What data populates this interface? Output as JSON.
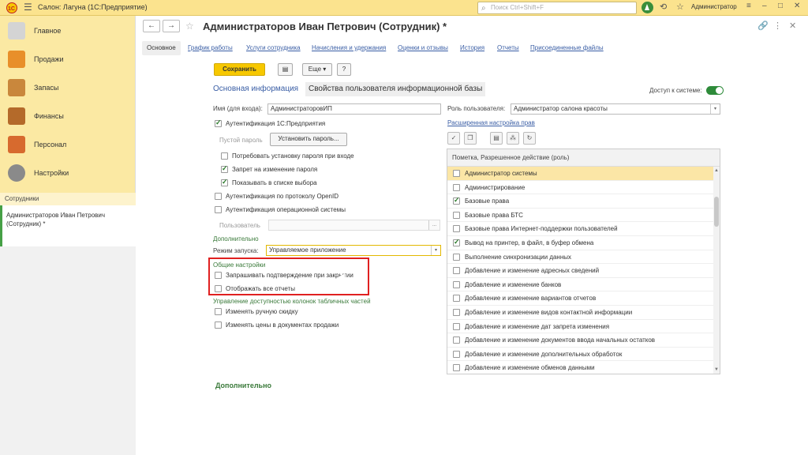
{
  "topbar": {
    "title": "Салон: Лагуна  (1С:Предприятие)",
    "search_placeholder": "Поиск Ctrl+Shift+F",
    "user": "Администратор",
    "icons": [
      "hamburger-icon",
      "bell-icon",
      "history-icon",
      "star-icon",
      "settings-icon",
      "minimize-icon",
      "maximize-icon",
      "close-icon"
    ]
  },
  "sidebar": {
    "items": [
      {
        "label": "Главное",
        "icon": "home-icon"
      },
      {
        "label": "Продажи",
        "icon": "sales-icon"
      },
      {
        "label": "Запасы",
        "icon": "inventory-icon"
      },
      {
        "label": "Финансы",
        "icon": "wallet-icon"
      },
      {
        "label": "Персонал",
        "icon": "people-icon"
      },
      {
        "label": "Настройки",
        "icon": "gear-icon"
      }
    ],
    "section_label": "Сотрудники",
    "open_window": "Администраторов Иван Петрович (Сотрудник) *"
  },
  "window": {
    "title": "Администраторов Иван Петрович (Сотрудник) *",
    "tabs": [
      {
        "label": "Основное",
        "active": true
      },
      {
        "label": "График работы"
      },
      {
        "label": "Услуги сотрудника"
      },
      {
        "label": "Начисления и удержания"
      },
      {
        "label": "Оценки и отзывы"
      },
      {
        "label": "История"
      },
      {
        "label": "Отчеты"
      },
      {
        "label": "Присоединенные файлы"
      }
    ]
  },
  "toolbar": {
    "save_label": "Сохранить",
    "more_label": "Еще",
    "help_label": "?"
  },
  "form": {
    "section_main": "Основная информация",
    "section_props": "Свойства пользователя информационной базы",
    "access_label": "Доступ к системе:",
    "access_enabled": true,
    "login_label": "Имя (для входа):",
    "login_value": "АдминистраторовИП",
    "auth_1c_label": "Аутентификация 1С:Предприятия",
    "auth_1c_checked": true,
    "empty_password_label": "Пустой пароль",
    "set_password_label": "Установить пароль...",
    "require_pwd_label": "Потребовать установку пароля при входе",
    "require_pwd_checked": false,
    "forbid_change_label": "Запрет на изменение пароля",
    "forbid_change_checked": true,
    "show_in_list_label": "Показывать в списке выбора",
    "show_in_list_checked": true,
    "openid_label": "Аутентификация по протоколу OpenID",
    "openid_checked": false,
    "os_auth_label": "Аутентификация операционной системы",
    "os_auth_checked": false,
    "os_user_label": "Пользователь",
    "os_user_more": "...",
    "additional_head": "Дополнительно",
    "launch_mode_label": "Режим запуска:",
    "launch_mode_value": "Управляемое приложение",
    "general_head": "Общие настройки",
    "ask_confirm_label": "Запрашивать подтверждение при закрытии",
    "ask_confirm_checked": false,
    "show_reports_label": "Отображать все отчеты",
    "show_reports_checked": false,
    "columns_head": "Управление доступностью колонок табличных частей",
    "change_discount_label": "Изменять ручную скидку",
    "change_discount_checked": false,
    "change_prices_label": "Изменять цены в документах продажи",
    "change_prices_checked": false,
    "bottom_additional": "Дополнительно",
    "role_label": "Роль пользователя:",
    "role_value": "Администратор салона красоты",
    "advanced_rights_link": "Расширенная настройка прав"
  },
  "role_table": {
    "header": "Пометка, Разрешенное действие (роль)",
    "rows": [
      {
        "label": "Администратор системы",
        "checked": false,
        "selected": true
      },
      {
        "label": "Администрирование",
        "checked": false
      },
      {
        "label": "Базовые права",
        "checked": true
      },
      {
        "label": "Базовые права БТС",
        "checked": false
      },
      {
        "label": "Базовые права Интернет-поддержки пользователей",
        "checked": false
      },
      {
        "label": "Вывод на принтер, в файл, в буфер обмена",
        "checked": true
      },
      {
        "label": "Выполнение синхронизации данных",
        "checked": false
      },
      {
        "label": "Добавление и изменение адресных сведений",
        "checked": false
      },
      {
        "label": "Добавление и изменение банков",
        "checked": false
      },
      {
        "label": "Добавление и изменение вариантов отчетов",
        "checked": false
      },
      {
        "label": "Добавление и изменение видов контактной информации",
        "checked": false
      },
      {
        "label": "Добавление и изменение дат запрета изменения",
        "checked": false
      },
      {
        "label": "Добавление и изменение документов ввода начальных остатков",
        "checked": false
      },
      {
        "label": "Добавление и изменение дополнительных обработок",
        "checked": false
      },
      {
        "label": "Добавление и изменение обменов данными",
        "checked": false
      }
    ]
  },
  "colors": {
    "topbar": "#fbe38e",
    "sidebar": "#fbe9a3",
    "save_button": "#f7c800",
    "green_accent": "#2e8b3a",
    "highlight_box": "#e02020",
    "selected_row": "#fbe6a6"
  }
}
